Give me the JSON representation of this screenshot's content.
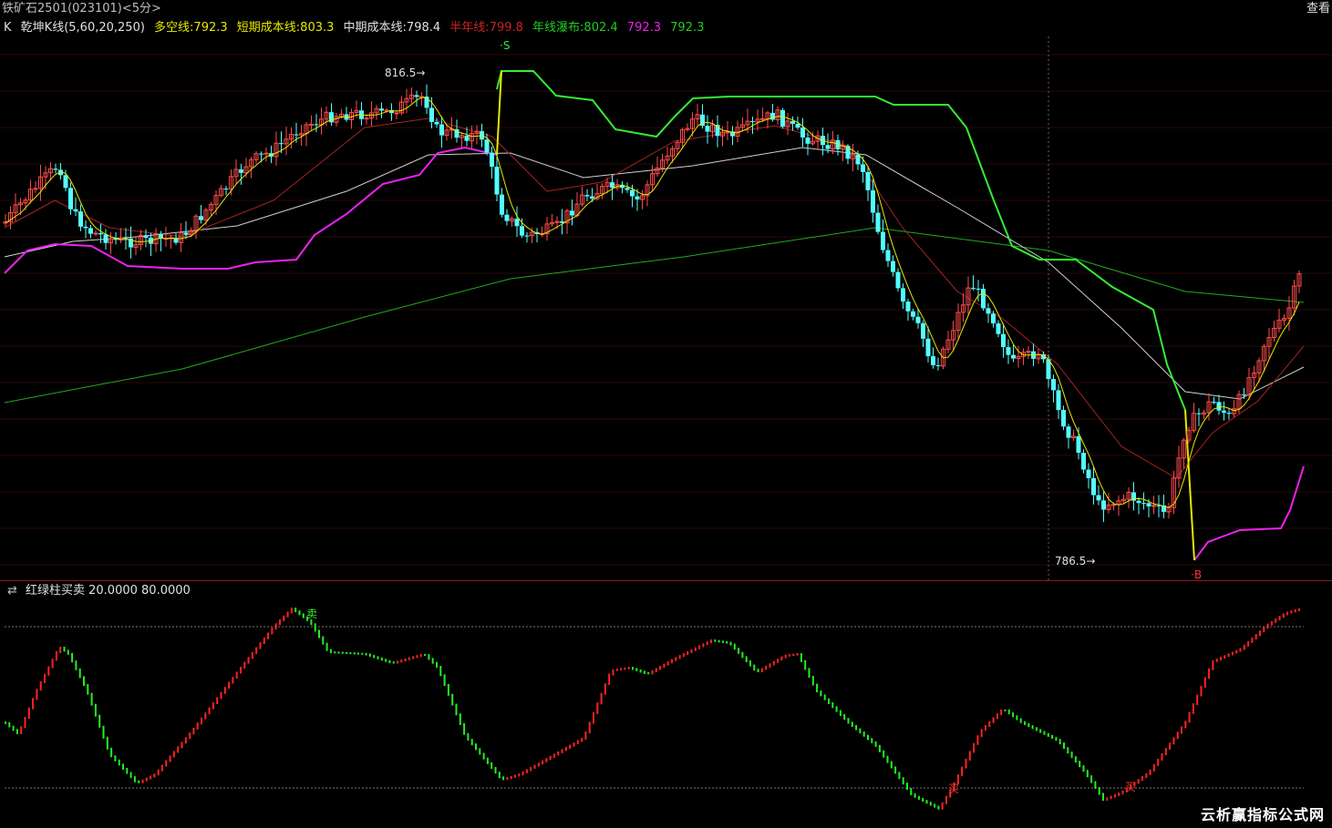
{
  "window": {
    "title": "铁矿石2501(023101)<5分>",
    "right_button": "查看"
  },
  "main_legend": {
    "k_label": "K",
    "indicator": "乾坤K线(5,60,20,250)",
    "items": [
      {
        "label": "多空线:792.3",
        "color": "#e8e800"
      },
      {
        "label": "短期成本线:803.3",
        "color": "#e8e800"
      },
      {
        "label": "中期成本线:798.4",
        "color": "#e0e0e0"
      },
      {
        "label": "半年线:799.8",
        "color": "#cc2222"
      },
      {
        "label": "年线瀑布:802.4",
        "color": "#22cc22"
      },
      {
        "label": "792.3",
        "color": "#ee22ee"
      },
      {
        "label": "792.3",
        "color": "#22cc22"
      }
    ]
  },
  "sub_legend": {
    "icon": "swap-icon",
    "text": "红绿柱买卖 20.0000 80.0000"
  },
  "annotations": {
    "high": "816.5→",
    "low": "786.5→",
    "sell_signal": "·S",
    "buy_signal": "·B",
    "sub_sell": "卖",
    "sub_buy1": "买",
    "sub_buy2": "买"
  },
  "watermark": "云析赢指标公式网",
  "chart_data": {
    "type": "candlestick",
    "title": "铁矿石2501(023101)<5分>",
    "y_high": 816.5,
    "y_low": 786.5,
    "colors": {
      "up": "#ff4a4a",
      "down": "#54ffff",
      "ma_short": "#e8e800",
      "ma_mid": "#d0d0d0",
      "ma_half": "#aa2222",
      "ma_year": "#22aa22",
      "band_upper": "#33ee33",
      "band_lower": "#ee22ee"
    },
    "sub_chart": {
      "name": "红绿柱买卖",
      "levels": [
        20,
        80
      ],
      "colors": {
        "rise": "#ff2222",
        "fall": "#22ee22"
      }
    }
  }
}
